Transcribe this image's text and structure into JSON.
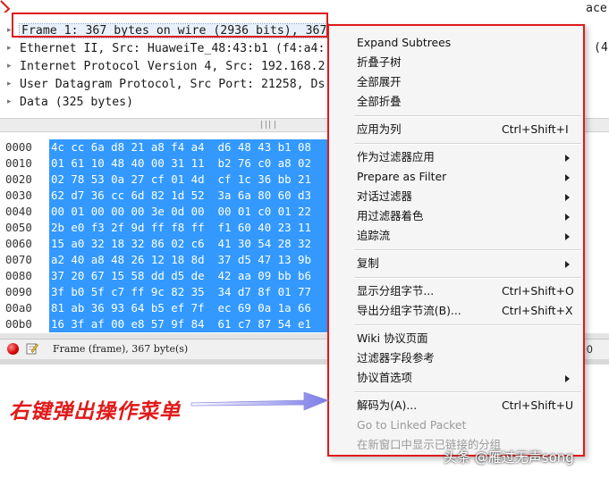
{
  "details": {
    "rows": [
      {
        "text": "Frame 1: 367 bytes on wire (2936 bits), 367"
      },
      {
        "text": "Ethernet II, Src: HuaweiTe_48:43:b1 (f4:a4:"
      },
      {
        "text": "Internet Protocol Version 4, Src: 192.168.2"
      },
      {
        "text": "User Datagram Protocol, Src Port: 21258, Ds"
      },
      {
        "text": "Data (325 bytes)"
      }
    ],
    "top_fragment": "ace",
    "right_fragment": "(4"
  },
  "hex": {
    "rows": [
      {
        "offset": "0000",
        "bytes": "4c cc 6a d8 21 a8 f4 a4  d6 48 43 b1 08"
      },
      {
        "offset": "0010",
        "bytes": "01 61 10 48 40 00 31 11  b2 76 c0 a8 02"
      },
      {
        "offset": "0020",
        "bytes": "02 78 53 0a 27 cf 01 4d  cf 1c 36 bb 21"
      },
      {
        "offset": "0030",
        "bytes": "62 d7 36 cc 6d 82 1d 52  3a 6a 80 60 d3"
      },
      {
        "offset": "0040",
        "bytes": "00 01 00 00 00 3e 0d 00  00 01 c0 01 22"
      },
      {
        "offset": "0050",
        "bytes": "2b e0 f3 2f 9d ff f8 ff  f1 60 40 23 11"
      },
      {
        "offset": "0060",
        "bytes": "15 a0 32 18 32 86 02 c6  41 30 54 28 32"
      },
      {
        "offset": "0070",
        "bytes": "a2 40 a8 48 26 12 18 8d  37 d5 47 13 9b"
      },
      {
        "offset": "0080",
        "bytes": "37 20 67 15 58 dd d5 de  42 aa 09 bb b6"
      },
      {
        "offset": "0090",
        "bytes": "3f b0 5f c7 ff 9c 82 35  34 d7 8f 01 77"
      },
      {
        "offset": "00a0",
        "bytes": "81 ab 36 93 64 b5 ef 7f  ec 69 0a 1a 66"
      },
      {
        "offset": "00b0",
        "bytes": "16 3f af 00 e8 57 9f 84  61 c7 87 54 e1"
      }
    ]
  },
  "status": {
    "text": "Frame (frame), 367 byte(s)",
    "right_num": "0"
  },
  "menu": {
    "items": [
      {
        "label": "Expand Subtrees",
        "shortcut": "",
        "submenu": false,
        "disabled": false
      },
      {
        "label": "折叠子树",
        "shortcut": "",
        "submenu": false,
        "disabled": false
      },
      {
        "label": "全部展开",
        "shortcut": "",
        "submenu": false,
        "disabled": false
      },
      {
        "label": "全部折叠",
        "shortcut": "",
        "submenu": false,
        "disabled": false
      },
      {
        "label": "应用为列",
        "shortcut": "Ctrl+Shift+I",
        "submenu": false,
        "disabled": false
      },
      {
        "label": "作为过滤器应用",
        "shortcut": "",
        "submenu": true,
        "disabled": false
      },
      {
        "label": "Prepare as Filter",
        "shortcut": "",
        "submenu": true,
        "disabled": false
      },
      {
        "label": "对话过滤器",
        "shortcut": "",
        "submenu": true,
        "disabled": false
      },
      {
        "label": "用过滤器着色",
        "shortcut": "",
        "submenu": true,
        "disabled": false
      },
      {
        "label": "追踪流",
        "shortcut": "",
        "submenu": true,
        "disabled": false
      },
      {
        "label": "复制",
        "shortcut": "",
        "submenu": true,
        "disabled": false
      },
      {
        "label": "显示分组字节...",
        "shortcut": "Ctrl+Shift+O",
        "submenu": false,
        "disabled": false
      },
      {
        "label": "导出分组字节流(B)...",
        "shortcut": "Ctrl+Shift+X",
        "submenu": false,
        "disabled": false
      },
      {
        "label": "Wiki 协议页面",
        "shortcut": "",
        "submenu": false,
        "disabled": false
      },
      {
        "label": "过滤器字段参考",
        "shortcut": "",
        "submenu": false,
        "disabled": false
      },
      {
        "label": "协议首选项",
        "shortcut": "",
        "submenu": true,
        "disabled": false
      },
      {
        "label": "解码为(A)...",
        "shortcut": "Ctrl+Shift+U",
        "submenu": false,
        "disabled": false
      },
      {
        "label": "Go to Linked Packet",
        "shortcut": "",
        "submenu": false,
        "disabled": true
      },
      {
        "label": "在新窗口中显示已链接的分组",
        "shortcut": "",
        "submenu": false,
        "disabled": true
      }
    ]
  },
  "annotation": {
    "text": "右键弹出操作菜单",
    "color": "#e01a1a"
  },
  "watermark": {
    "text": "头条 @雁过无声song"
  },
  "colors": {
    "selection": "#3399ff",
    "annotation_red": "#e01a1a",
    "arrow_blue": "#7b7be8"
  }
}
